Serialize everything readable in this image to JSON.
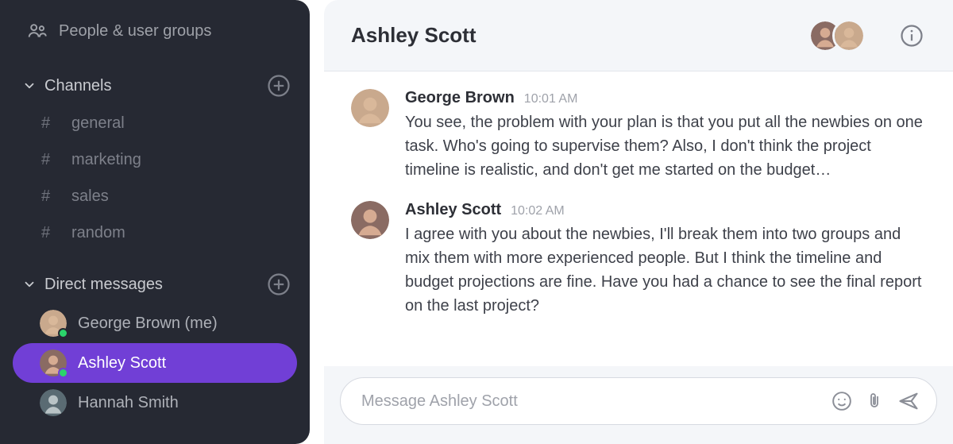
{
  "colors": {
    "sidebar_bg": "#262933",
    "accent": "#713fd6",
    "presence_online": "#2bd46b"
  },
  "sidebar": {
    "people_label": "People & user groups",
    "channels_header": "Channels",
    "channels": [
      {
        "name": "general"
      },
      {
        "name": "marketing"
      },
      {
        "name": "sales"
      },
      {
        "name": "random"
      }
    ],
    "dm_header": "Direct messages",
    "dms": [
      {
        "name": "George Brown (me)",
        "online": true,
        "active": false,
        "avatar": "george"
      },
      {
        "name": "Ashley Scott",
        "online": true,
        "active": true,
        "avatar": "ashley"
      },
      {
        "name": "Hannah Smith",
        "online": false,
        "active": false,
        "avatar": "hannah"
      }
    ]
  },
  "conversation": {
    "title": "Ashley Scott",
    "participants": [
      "ashley",
      "george"
    ],
    "messages": [
      {
        "author": "George Brown",
        "time": "10:01 AM",
        "avatar": "george",
        "text": "You see, the problem with your plan is that you put all the newbies on one task. Who's going to supervise them? Also, I don't think the project timeline is realistic, and don't get me started on the budget…"
      },
      {
        "author": "Ashley Scott",
        "time": "10:02 AM",
        "avatar": "ashley",
        "text": "I agree with you about the newbies, I'll break them into two groups and mix them with more experienced people. But I think the timeline and budget projections are fine. Have you had a chance to see the final report on the last project?"
      }
    ],
    "composer_placeholder": "Message Ashley Scott"
  },
  "avatars": {
    "george": {
      "bg": "#c9a98d",
      "face": "#d9b89a"
    },
    "ashley": {
      "bg": "#8a6b63",
      "face": "#d6ab92"
    },
    "hannah": {
      "bg": "#5a6b73",
      "face": "#b9c3c6"
    }
  }
}
